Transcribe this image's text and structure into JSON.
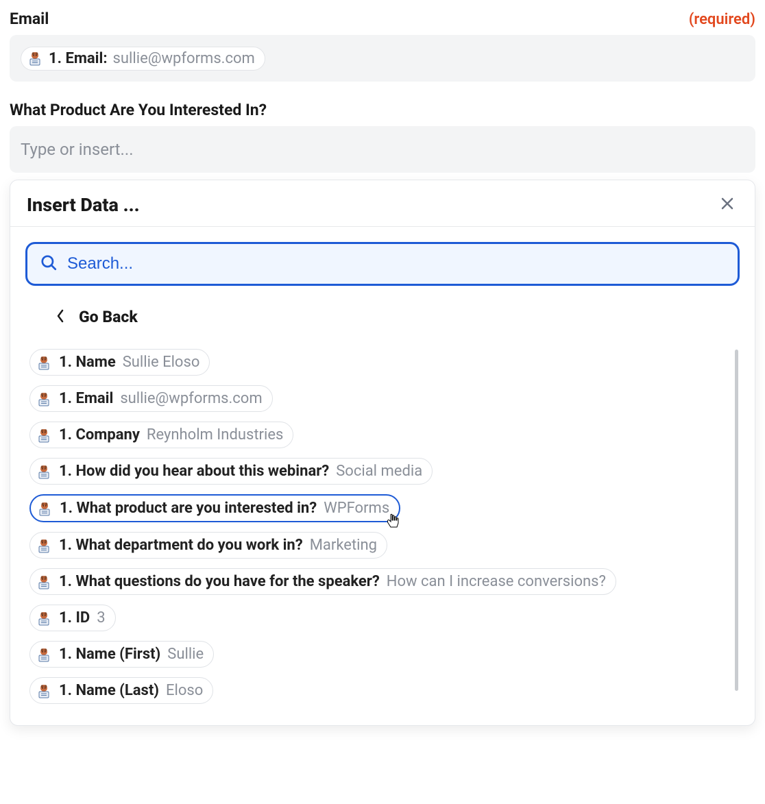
{
  "fields": {
    "email": {
      "label": "Email",
      "required_text": "(required)",
      "chip_label": "1. Email:",
      "chip_value": "sullie@wpforms.com"
    },
    "product": {
      "label": "What Product Are You Interested In?",
      "placeholder": "Type or insert..."
    }
  },
  "popup": {
    "title": "Insert Data ...",
    "search_placeholder": "Search...",
    "go_back": "Go Back",
    "items": [
      {
        "label": "1. Name",
        "value": "Sullie Eloso",
        "selected": false
      },
      {
        "label": "1. Email",
        "value": "sullie@wpforms.com",
        "selected": false
      },
      {
        "label": "1. Company",
        "value": "Reynholm Industries",
        "selected": false
      },
      {
        "label": "1. How did you hear about this webinar?",
        "value": "Social media",
        "selected": false
      },
      {
        "label": "1. What product are you interested in?",
        "value": "WPForms",
        "selected": true
      },
      {
        "label": "1. What department do you work in?",
        "value": "Marketing",
        "selected": false
      },
      {
        "label": "1. What questions do you have for the speaker?",
        "value": "How can I increase conversions?",
        "selected": false
      },
      {
        "label": "1. ID",
        "value": "3",
        "selected": false
      },
      {
        "label": "1. Name (First)",
        "value": "Sullie",
        "selected": false
      },
      {
        "label": "1. Name (Last)",
        "value": "Eloso",
        "selected": false
      }
    ]
  }
}
